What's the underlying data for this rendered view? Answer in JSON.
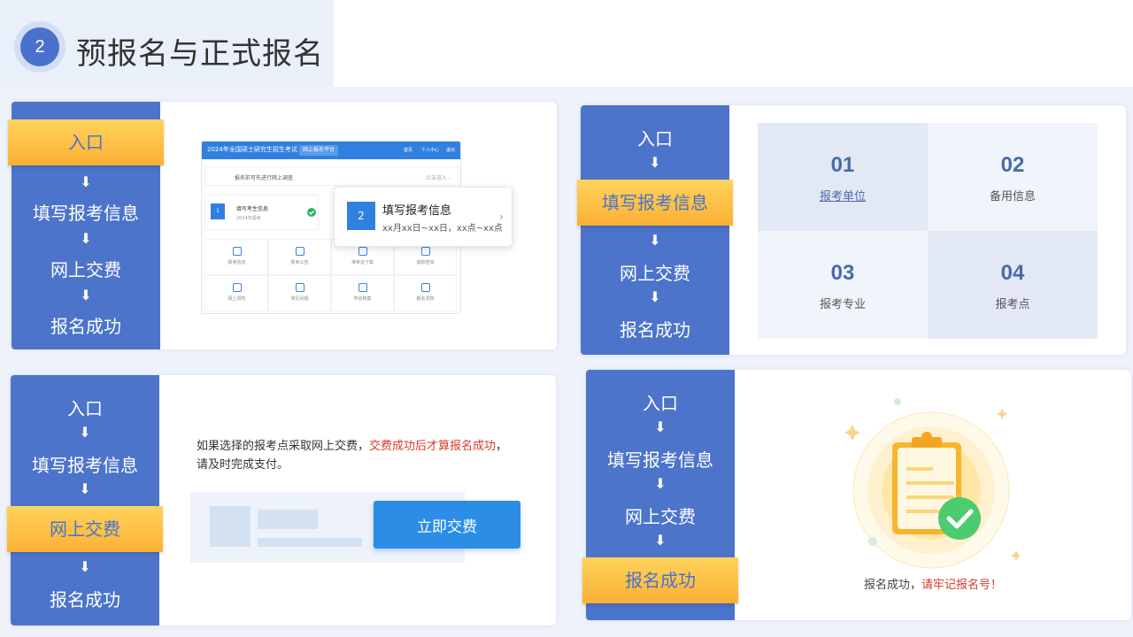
{
  "header": {
    "step": "2",
    "title": "预报名与正式报名"
  },
  "flow": {
    "entry": "入口",
    "fill": "填写报考信息",
    "pay": "网上交费",
    "success": "报名成功",
    "arrow": "⬇"
  },
  "panel1": {
    "mini": {
      "title": "2024年全国硕士研究生招生考试",
      "tag": "网上报名平台",
      "right_items": [
        "首页",
        "个人中心",
        "退出"
      ],
      "notice": "报名前可先进行网上调查",
      "notice_right": "点击进入 ›",
      "card_title": "填写考生信息",
      "card_sub": "2024年报考",
      "grid_items": [
        "报考信息",
        "报考公告",
        "准考证下载",
        "成绩查询",
        "网上调剂",
        "常见问题",
        "学信档案",
        "报名须知"
      ]
    },
    "popup": {
      "num": "2",
      "title": "填写报考信息",
      "subtitle": "xx月xx日~xx日，xx点~xx点",
      "chevron": "›"
    }
  },
  "panel2": {
    "cells": [
      {
        "num": "01",
        "label": "报考单位"
      },
      {
        "num": "02",
        "label": "备用信息"
      },
      {
        "num": "03",
        "label": "报考专业"
      },
      {
        "num": "04",
        "label": "报考点"
      }
    ]
  },
  "panel3": {
    "notice_normal": "如果选择的报考点采取网上交费，",
    "notice_red": "交费成功后才算报名成功",
    "notice_end": "，请及时完成支付。",
    "pay_button": "立即交费"
  },
  "panel4": {
    "text_normal": "报名成功，",
    "text_red": "请牢记报名号！"
  },
  "colors": {
    "sidebar": "#4c74cb",
    "active": "#fbb034",
    "accent": "#2b8de6",
    "warn": "#d93a28"
  }
}
